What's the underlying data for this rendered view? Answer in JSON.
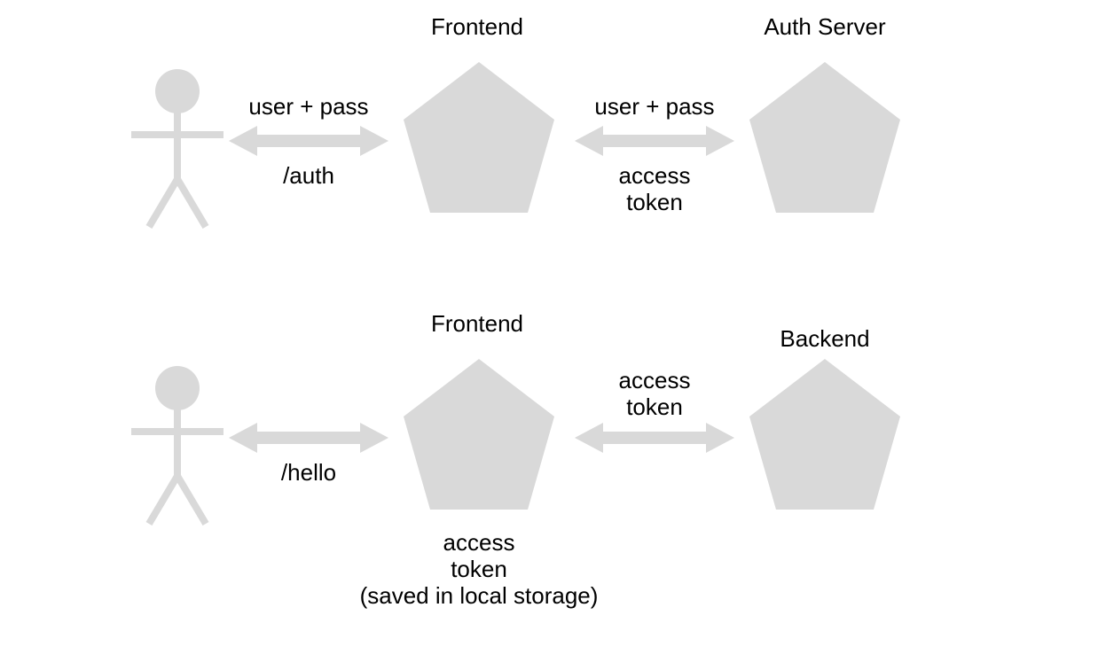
{
  "diagram": {
    "row1": {
      "frontend_title": "Frontend",
      "authserver_title": "Auth Server",
      "arrow1_top": "user + pass",
      "arrow1_bottom": "/auth",
      "arrow2_top": "user + pass",
      "arrow2_bottom": "access\ntoken"
    },
    "row2": {
      "frontend_title": "Frontend",
      "backend_title": "Backend",
      "arrow1_top": "",
      "arrow1_bottom": "/hello",
      "arrow2_top": "access\ntoken",
      "arrow2_bottom": "",
      "frontend_note": "access\ntoken\n(saved in local storage)"
    }
  },
  "colors": {
    "shape_fill": "#d9d9d9",
    "text": "#000000"
  }
}
